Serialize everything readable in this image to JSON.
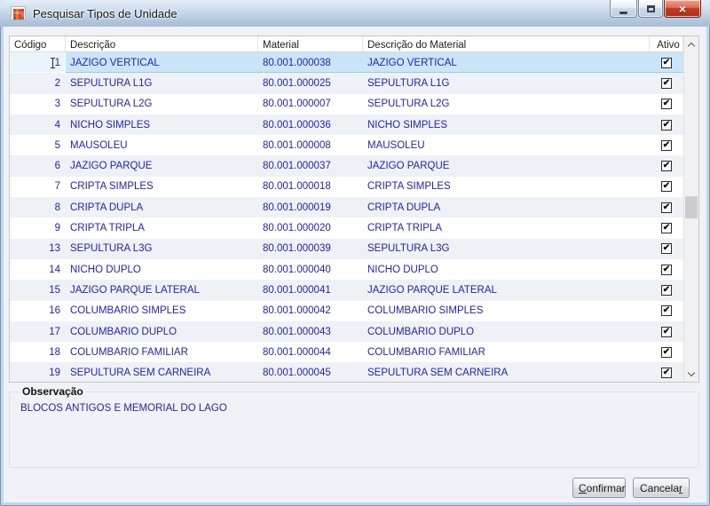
{
  "window": {
    "title": "Pesquisar Tipos de Unidade"
  },
  "table": {
    "columns": [
      "Código",
      "Descrição",
      "Material",
      "Descrição do Material",
      "Ativo"
    ],
    "rows": [
      {
        "codigo": "1",
        "descricao": "JAZIGO VERTICAL",
        "material": "80.001.000038",
        "material_descricao": "JAZIGO VERTICAL",
        "ativo": true,
        "selected": true
      },
      {
        "codigo": "2",
        "descricao": "SEPULTURA L1G",
        "material": "80.001.000025",
        "material_descricao": "SEPULTURA L1G",
        "ativo": true,
        "selected": false
      },
      {
        "codigo": "3",
        "descricao": "SEPULTURA L2G",
        "material": "80.001.000007",
        "material_descricao": "SEPULTURA L2G",
        "ativo": true,
        "selected": false
      },
      {
        "codigo": "4",
        "descricao": "NICHO SIMPLES",
        "material": "80.001.000036",
        "material_descricao": "NICHO SIMPLES",
        "ativo": true,
        "selected": false
      },
      {
        "codigo": "5",
        "descricao": "MAUSOLEU",
        "material": "80.001.000008",
        "material_descricao": "MAUSOLEU",
        "ativo": true,
        "selected": false
      },
      {
        "codigo": "6",
        "descricao": "JAZIGO PARQUE",
        "material": "80.001.000037",
        "material_descricao": "JAZIGO PARQUE",
        "ativo": true,
        "selected": false
      },
      {
        "codigo": "7",
        "descricao": "CRIPTA SIMPLES",
        "material": "80.001.000018",
        "material_descricao": "CRIPTA SIMPLES",
        "ativo": true,
        "selected": false
      },
      {
        "codigo": "8",
        "descricao": "CRIPTA DUPLA",
        "material": "80.001.000019",
        "material_descricao": "CRIPTA DUPLA",
        "ativo": true,
        "selected": false
      },
      {
        "codigo": "9",
        "descricao": "CRIPTA TRIPLA",
        "material": "80.001.000020",
        "material_descricao": "CRIPTA TRIPLA",
        "ativo": true,
        "selected": false
      },
      {
        "codigo": "13",
        "descricao": "SEPULTURA L3G",
        "material": "80.001.000039",
        "material_descricao": "SEPULTURA L3G",
        "ativo": true,
        "selected": false
      },
      {
        "codigo": "14",
        "descricao": "NICHO DUPLO",
        "material": "80.001.000040",
        "material_descricao": "NICHO DUPLO",
        "ativo": true,
        "selected": false
      },
      {
        "codigo": "15",
        "descricao": "JAZIGO PARQUE LATERAL",
        "material": "80.001.000041",
        "material_descricao": "JAZIGO PARQUE LATERAL",
        "ativo": true,
        "selected": false
      },
      {
        "codigo": "16",
        "descricao": "COLUMBARIO SIMPLES",
        "material": "80.001.000042",
        "material_descricao": "COLUMBARIO SIMPLES",
        "ativo": true,
        "selected": false
      },
      {
        "codigo": "17",
        "descricao": "COLUMBARIO DUPLO",
        "material": "80.001.000043",
        "material_descricao": "COLUMBARIO DUPLO",
        "ativo": true,
        "selected": false
      },
      {
        "codigo": "18",
        "descricao": "COLUMBARIO FAMILIAR",
        "material": "80.001.000044",
        "material_descricao": "COLUMBARIO FAMILIAR",
        "ativo": true,
        "selected": false
      },
      {
        "codigo": "19",
        "descricao": "SEPULTURA SEM CARNEIRA",
        "material": "80.001.000045",
        "material_descricao": "SEPULTURA SEM CARNEIRA",
        "ativo": true,
        "selected": false
      }
    ],
    "checkbox_glyph": "✔"
  },
  "observacao": {
    "label": "Observação",
    "text": "BLOCOS ANTIGOS E MEMORIAL DO LAGO"
  },
  "buttons": [
    {
      "label": "Confirmar",
      "underline_index": 0
    },
    {
      "label": "Cancelar",
      "underline_index": 7
    }
  ],
  "icons": {
    "close_glyph": "×"
  },
  "colors": {
    "titlebar_top": "#e6eef8",
    "titlebar_bottom": "#a5bcd4",
    "frame": "#c3d6ec",
    "client_bg": "#f0f2f7",
    "selection": "#cbe5f8",
    "row_alt": "#eef1f6",
    "row_text": "#2424a4",
    "close_button": "#c23a24"
  }
}
